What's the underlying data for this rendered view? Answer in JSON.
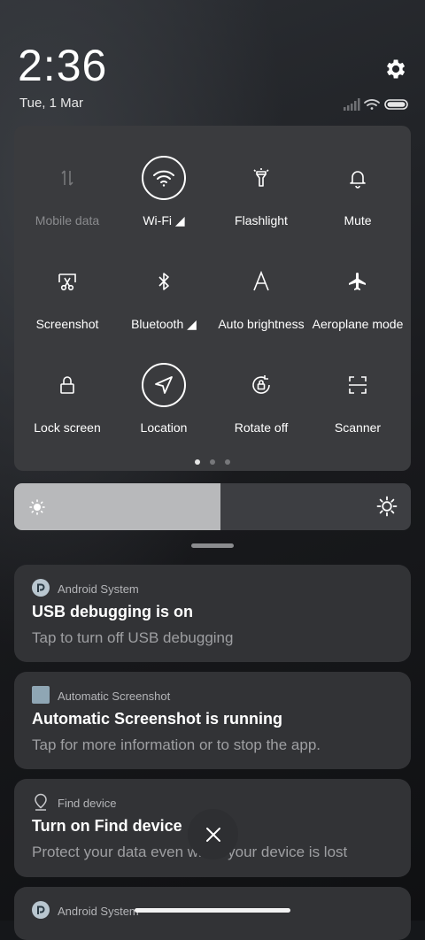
{
  "status": {
    "time": "2:36",
    "date": "Tue, 1 Mar"
  },
  "icons": {
    "settings": "gear-icon",
    "signal": "signal-icon",
    "wifi": "wifi-icon",
    "battery": "battery-icon"
  },
  "quick_settings": {
    "tiles": [
      {
        "label": "Mobile data",
        "icon": "mobile-data-icon",
        "active": false,
        "disabled": true
      },
      {
        "label": "Wi-Fi ◢",
        "icon": "wifi-icon",
        "active": true
      },
      {
        "label": "Flashlight",
        "icon": "flashlight-icon",
        "active": false
      },
      {
        "label": "Mute",
        "icon": "bell-icon",
        "active": false
      },
      {
        "label": "Screenshot",
        "icon": "screenshot-icon",
        "active": false
      },
      {
        "label": "Bluetooth ◢",
        "icon": "bluetooth-icon",
        "active": false
      },
      {
        "label": "Auto brightness",
        "icon": "auto-brightness-icon",
        "active": false
      },
      {
        "label": "Aeroplane mode",
        "icon": "airplane-icon",
        "active": false
      },
      {
        "label": "Lock screen",
        "icon": "lock-icon",
        "active": false
      },
      {
        "label": "Location",
        "icon": "location-icon",
        "active": true
      },
      {
        "label": "Rotate off",
        "icon": "rotate-lock-icon",
        "active": false
      },
      {
        "label": "Scanner",
        "icon": "scanner-icon",
        "active": false
      }
    ],
    "page": 1,
    "page_count": 3
  },
  "brightness": {
    "level": 0.52
  },
  "notifications": [
    {
      "app": "Android System",
      "title": "USB debugging is on",
      "body": "Tap to turn off USB debugging",
      "icon": "android-system-icon"
    },
    {
      "app": "Automatic Screenshot",
      "title": "Automatic Screenshot is running",
      "body": "Tap for more information or to stop the app.",
      "icon": "app-square-icon"
    },
    {
      "app": "Find device",
      "title": "Turn on Find device",
      "body": "Protect your data even when your device is lost",
      "icon": "location-pin-icon"
    },
    {
      "app": "Android System",
      "icon": "android-system-icon"
    }
  ],
  "colors": {
    "panel": "#3a3b3e",
    "card": "#323336",
    "accent": "#ffffff",
    "dim_text": "#9e9fa2"
  }
}
